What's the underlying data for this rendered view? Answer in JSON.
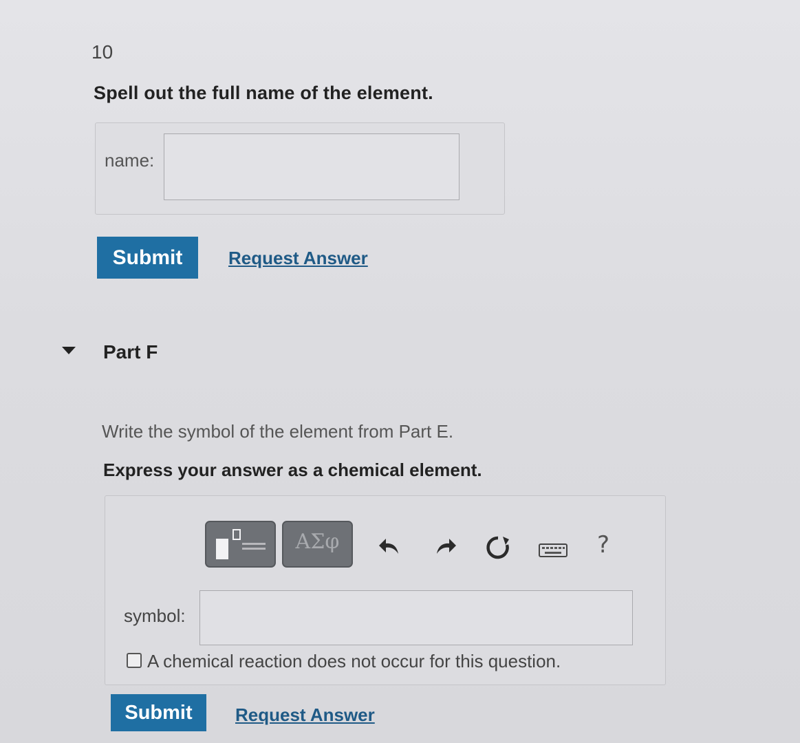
{
  "question_number": "10",
  "part_e": {
    "prompt": "Spell out the full name of the element.",
    "field_label": "name:",
    "field_value": "",
    "submit_label": "Submit",
    "request_answer_label": "Request Answer"
  },
  "part_f": {
    "title": "Part F",
    "description": "Write the symbol of the element from Part E.",
    "instruction": "Express your answer as a chemical element.",
    "toolbar": {
      "greek_label": "ΑΣφ",
      "help_label": "?",
      "icons": [
        "templates-icon",
        "greek-symbols-icon",
        "undo-icon",
        "redo-icon",
        "reset-icon",
        "keyboard-icon",
        "help-icon"
      ]
    },
    "field_label": "symbol:",
    "field_value": "",
    "checkbox_label": "A chemical reaction does not occur for this question.",
    "checkbox_checked": false,
    "submit_label": "Submit",
    "request_answer_label": "Request Answer"
  },
  "colors": {
    "primary_button": "#1f6fa3",
    "link": "#1f5a86",
    "toolbar_button": "#6e7176"
  }
}
